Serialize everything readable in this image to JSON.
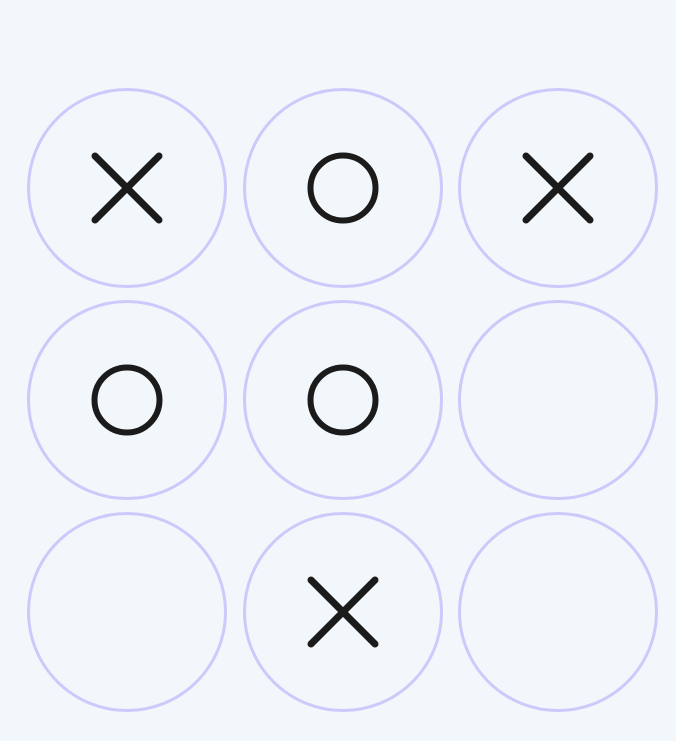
{
  "board": {
    "cells": [
      "X",
      "O",
      "X",
      "O",
      "O",
      "",
      "",
      "X",
      ""
    ]
  },
  "colors": {
    "background": "#f2f7fc",
    "cell_border": "#cdc9fa",
    "mark": "#1b1b1b"
  },
  "icons": {
    "X": "cross-icon",
    "O": "circle-icon"
  }
}
